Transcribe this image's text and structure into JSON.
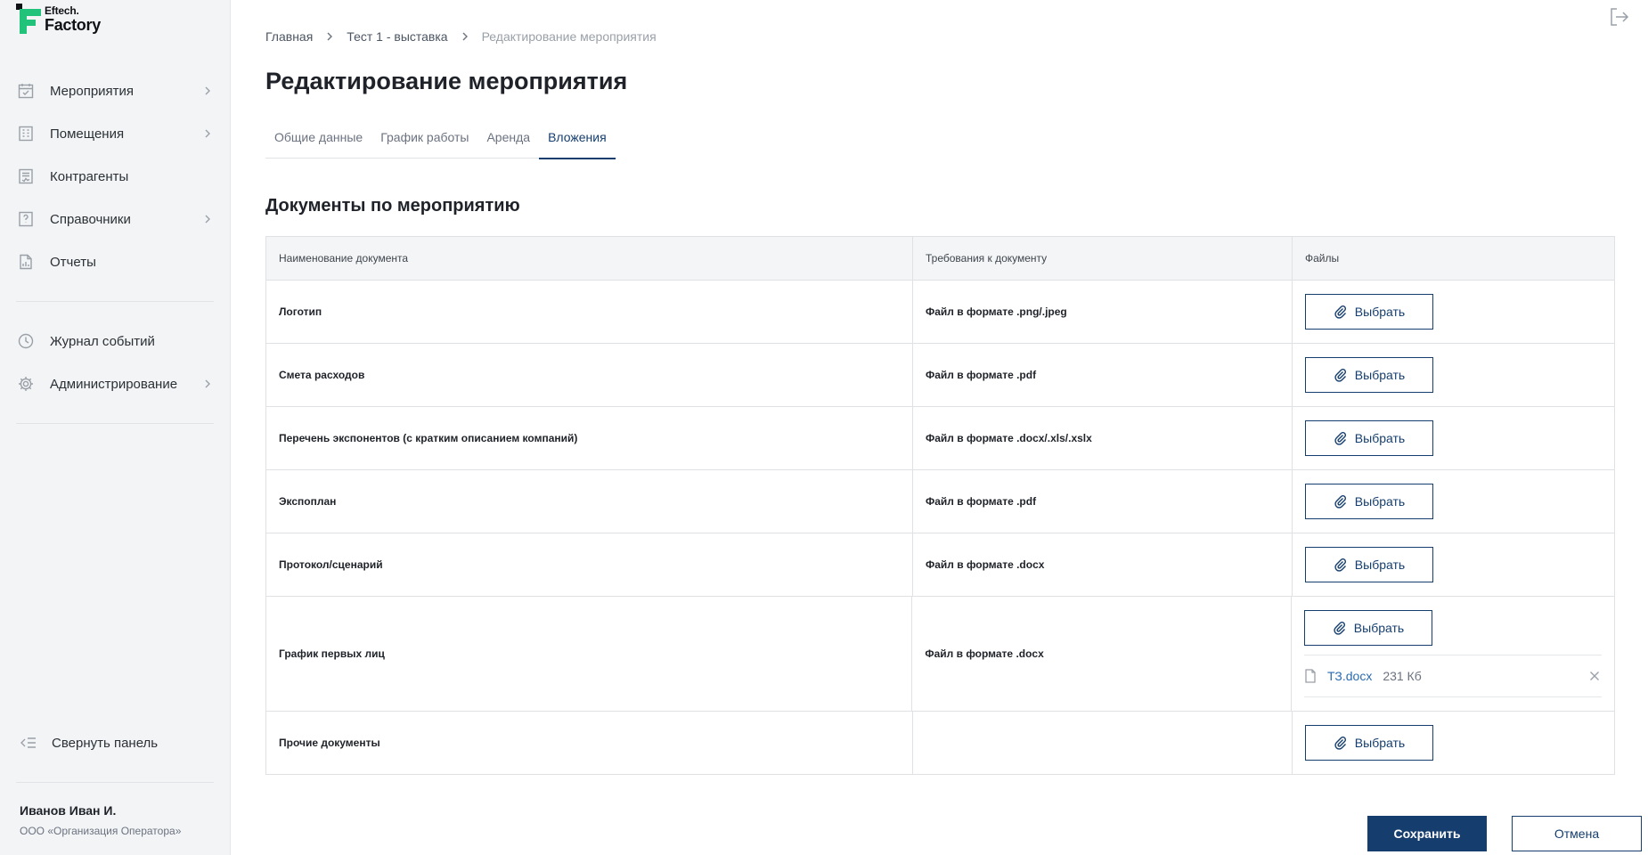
{
  "logo": {
    "line1": "Eftech.",
    "line2": "Factory",
    "colors": {
      "accent": "#21c37a",
      "dark": "#0f1115"
    }
  },
  "sidebar": {
    "items": [
      {
        "label": "Мероприятия",
        "icon": "calendar-check-icon",
        "has_children": true
      },
      {
        "label": "Помещения",
        "icon": "building-icon",
        "has_children": true
      },
      {
        "label": "Контрагенты",
        "icon": "contract-icon",
        "has_children": false
      },
      {
        "label": "Справочники",
        "icon": "reference-book-icon",
        "has_children": true
      },
      {
        "label": "Отчеты",
        "icon": "report-icon",
        "has_children": false
      }
    ],
    "items2": [
      {
        "label": "Журнал событий",
        "icon": "clock-icon",
        "has_children": false
      },
      {
        "label": "Администрирование",
        "icon": "gear-icon",
        "has_children": true
      }
    ],
    "collapse_label": "Свернуть панель",
    "user": {
      "name": "Иванов Иван И.",
      "org": "ООО «Организация Оператора»"
    }
  },
  "breadcrumb": [
    "Главная",
    "Тест 1 - выставка",
    "Редактирование мероприятия"
  ],
  "page_title": "Редактирование мероприятия",
  "tabs": [
    {
      "label": "Общие данные",
      "active": false
    },
    {
      "label": "График работы",
      "active": false
    },
    {
      "label": "Аренда",
      "active": false
    },
    {
      "label": "Вложения",
      "active": true
    }
  ],
  "section_title": "Документы по мероприятию",
  "table": {
    "headers": [
      "Наименование документа",
      "Требования к документу",
      "Файлы"
    ],
    "rows": [
      {
        "name": "Логотип",
        "req": "Файл в формате .png/.jpeg"
      },
      {
        "name": "Смета расходов",
        "req": "Файл в формате .pdf"
      },
      {
        "name": "Перечень экспонентов (с кратким описанием компаний)",
        "req": "Файл в формате .docx/.xls/.xslx"
      },
      {
        "name": "Экспоплан",
        "req": "Файл в формате .pdf"
      },
      {
        "name": "Протокол/сценарий",
        "req": "Файл в формате .docx"
      },
      {
        "name": "График первых лиц",
        "req": "Файл в формате .docx",
        "file": {
          "name": "ТЗ.docx",
          "size": "231 Кб"
        }
      },
      {
        "name": "Прочие документы",
        "req": ""
      }
    ],
    "select_label": "Выбрать"
  },
  "actions": {
    "save": "Сохранить",
    "cancel": "Отмена"
  },
  "colors": {
    "primary": "#153e6e",
    "link": "#2b6cb0",
    "sidebar_bg": "#f3f4f5"
  }
}
